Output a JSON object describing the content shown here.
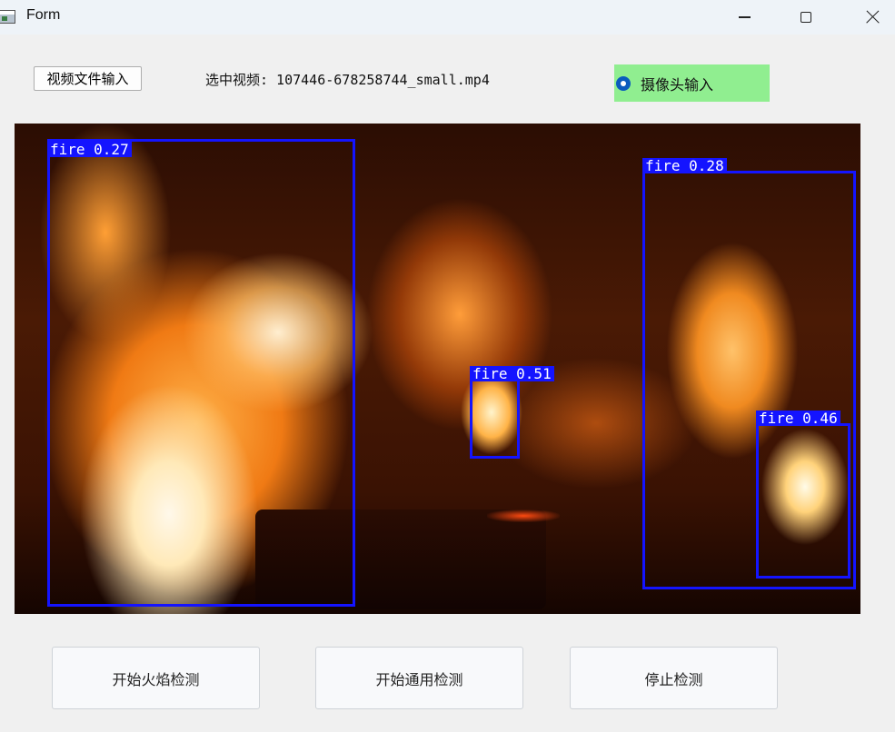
{
  "window": {
    "title": "Form",
    "controls": [
      "minimize",
      "maximize",
      "close"
    ]
  },
  "controls": {
    "video_file_button_label": "视频文件输入",
    "selected_video_text": "选中视频: 107446-678258744_small.mp4",
    "camera_radio_label": "摄像头输入",
    "camera_radio_checked": true,
    "camera_radio_bg": "#90ee90"
  },
  "video": {
    "detections": [
      {
        "label": "fire 0.27"
      },
      {
        "label": "fire 0.28"
      },
      {
        "label": "fire 0.51"
      },
      {
        "label": "fire 0.46"
      }
    ],
    "box_color": "#1414ff"
  },
  "actions": {
    "start_fire_detection": "开始火焰检测",
    "start_general_detection": "开始通用检测",
    "stop_detection": "停止检测"
  }
}
